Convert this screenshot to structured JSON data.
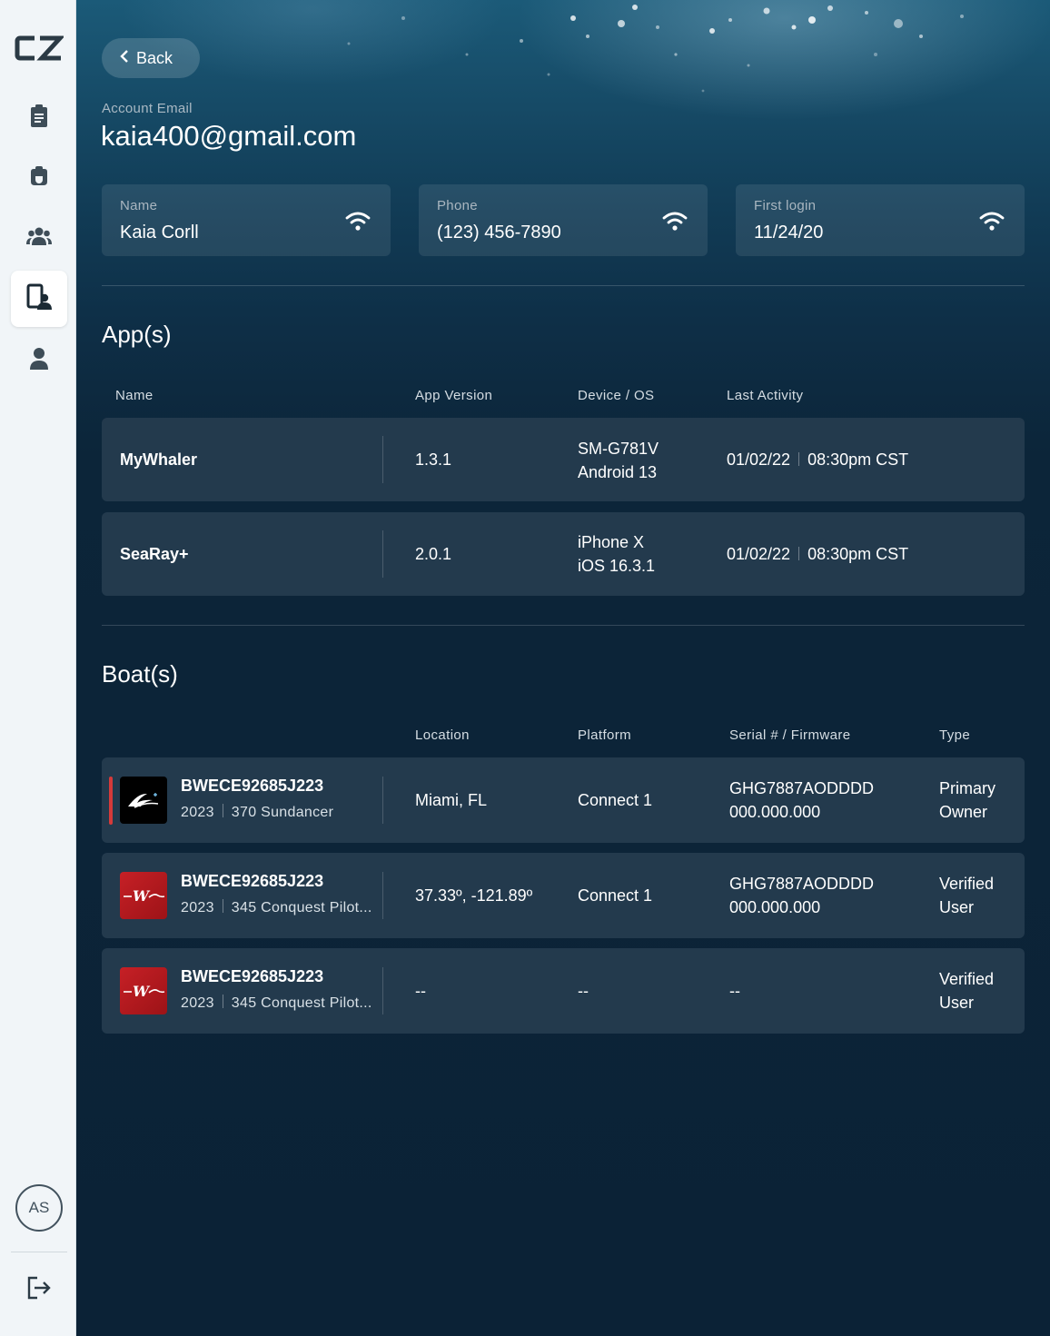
{
  "sidebar": {
    "logo_text": "CZ",
    "nav": [
      {
        "icon": "clipboard-icon"
      },
      {
        "icon": "boat-icon"
      },
      {
        "icon": "users-icon"
      },
      {
        "icon": "device-user-icon",
        "active": true
      },
      {
        "icon": "person-icon"
      }
    ],
    "avatar_initials": "AS",
    "logout_icon": "logout-icon"
  },
  "header": {
    "back_label": "Back",
    "account_email_label": "Account Email",
    "account_email": "kaia400@gmail.com"
  },
  "info_cards": [
    {
      "label": "Name",
      "value": "Kaia Corll",
      "icon": "wifi-icon"
    },
    {
      "label": "Phone",
      "value": "(123) 456-7890",
      "icon": "wifi-icon"
    },
    {
      "label": "First login",
      "value": "11/24/20",
      "icon": "wifi-icon"
    }
  ],
  "apps": {
    "title": "App(s)",
    "columns": [
      "Name",
      "App Version",
      "Device / OS",
      "Last Activity"
    ],
    "rows": [
      {
        "name": "MyWhaler",
        "version": "1.3.1",
        "device": "SM-G781V",
        "os": "Android 13",
        "date": "01/02/22",
        "time": "08:30pm CST"
      },
      {
        "name": "SeaRay+",
        "version": "2.0.1",
        "device": "iPhone X",
        "os": "iOS 16.3.1",
        "date": "01/02/22",
        "time": "08:30pm CST"
      }
    ]
  },
  "boats": {
    "title": "Boat(s)",
    "columns": [
      "Location",
      "Platform",
      "Serial # / Firmware",
      "Type"
    ],
    "rows": [
      {
        "hin": "BWECE92685J223",
        "year": "2023",
        "model": "370 Sundancer",
        "location": "Miami, FL",
        "platform": "Connect 1",
        "serial": "GHG7887AODDDD",
        "firmware": "000.000.000",
        "type_line1": "Primary",
        "type_line2": "Owner",
        "brand": "searay",
        "brand_color": "#000000",
        "accent_color": "#d63a3a"
      },
      {
        "hin": "BWECE92685J223",
        "year": "2023",
        "model": "345 Conquest Pilot...",
        "location": "37.33º, -121.89º",
        "platform": "Connect 1",
        "serial": "GHG7887AODDDD",
        "firmware": "000.000.000",
        "type_line1": "Verified",
        "type_line2": "User",
        "brand": "whaler",
        "brand_color": "#c62026"
      },
      {
        "hin": "BWECE92685J223",
        "year": "2023",
        "model": "345 Conquest Pilot...",
        "location": "--",
        "platform": "--",
        "serial": "--",
        "firmware": "",
        "type_line1": "Verified",
        "type_line2": "User",
        "brand": "whaler",
        "brand_color": "#c62026"
      }
    ]
  }
}
